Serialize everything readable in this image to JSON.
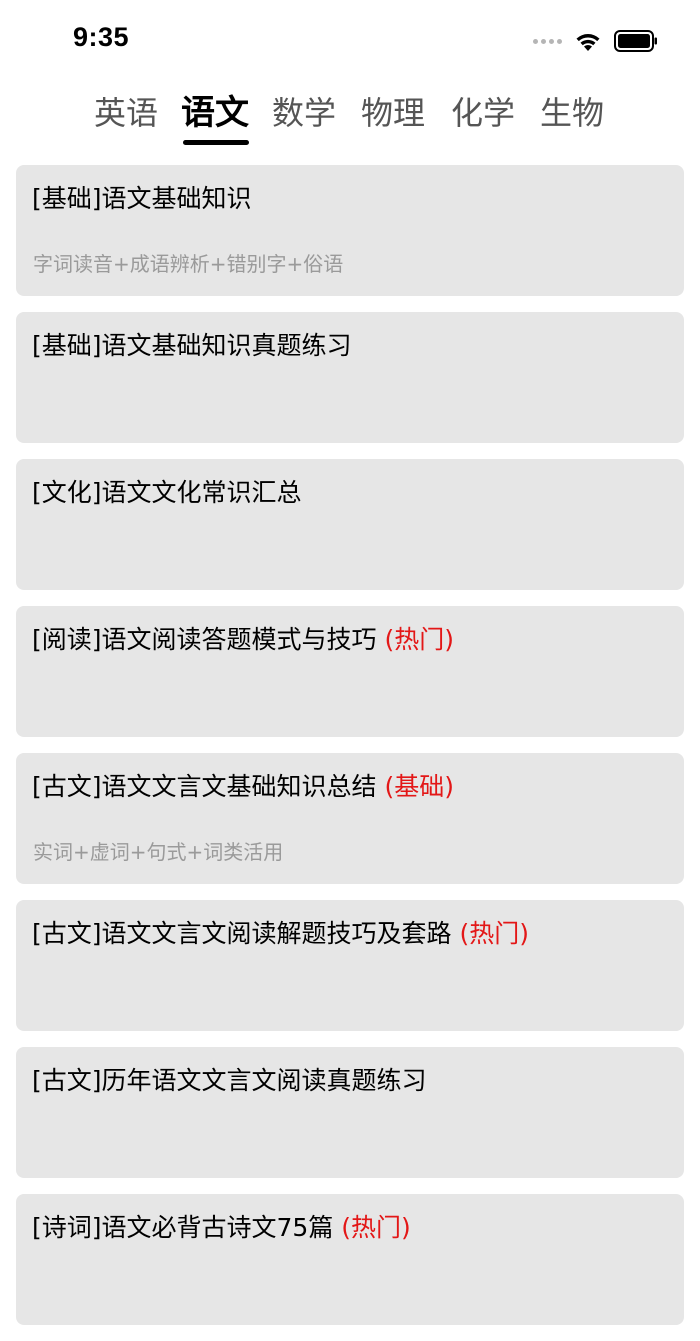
{
  "status_bar": {
    "time": "9:35"
  },
  "tabs": [
    {
      "label": "英语",
      "active": false
    },
    {
      "label": "语文",
      "active": true
    },
    {
      "label": "数学",
      "active": false
    },
    {
      "label": "物理",
      "active": false
    },
    {
      "label": "化学",
      "active": false
    },
    {
      "label": "生物",
      "active": false
    }
  ],
  "colors": {
    "card_bg": "#e6e6e6",
    "tag": "#e31717",
    "subtitle": "#9a9a9a"
  },
  "items": [
    {
      "title": "[基础]语文基础知识",
      "tag": "",
      "subtitle": "字词读音+成语辨析+错别字+俗语"
    },
    {
      "title": "[基础]语文基础知识真题练习",
      "tag": "",
      "subtitle": ""
    },
    {
      "title": "[文化]语文文化常识汇总",
      "tag": "",
      "subtitle": ""
    },
    {
      "title": "[阅读]语文阅读答题模式与技巧",
      "tag": "(热门)",
      "subtitle": ""
    },
    {
      "title": "[古文]语文文言文基础知识总结",
      "tag": "(基础)",
      "subtitle": "实词+虚词+句式+词类活用"
    },
    {
      "title": "[古文]语文文言文阅读解题技巧及套路",
      "tag": "(热门)",
      "subtitle": ""
    },
    {
      "title": "[古文]历年语文文言文阅读真题练习",
      "tag": "",
      "subtitle": ""
    },
    {
      "title": "[诗词]语文必背古诗文75篇",
      "tag": "(热门)",
      "subtitle": ""
    }
  ]
}
